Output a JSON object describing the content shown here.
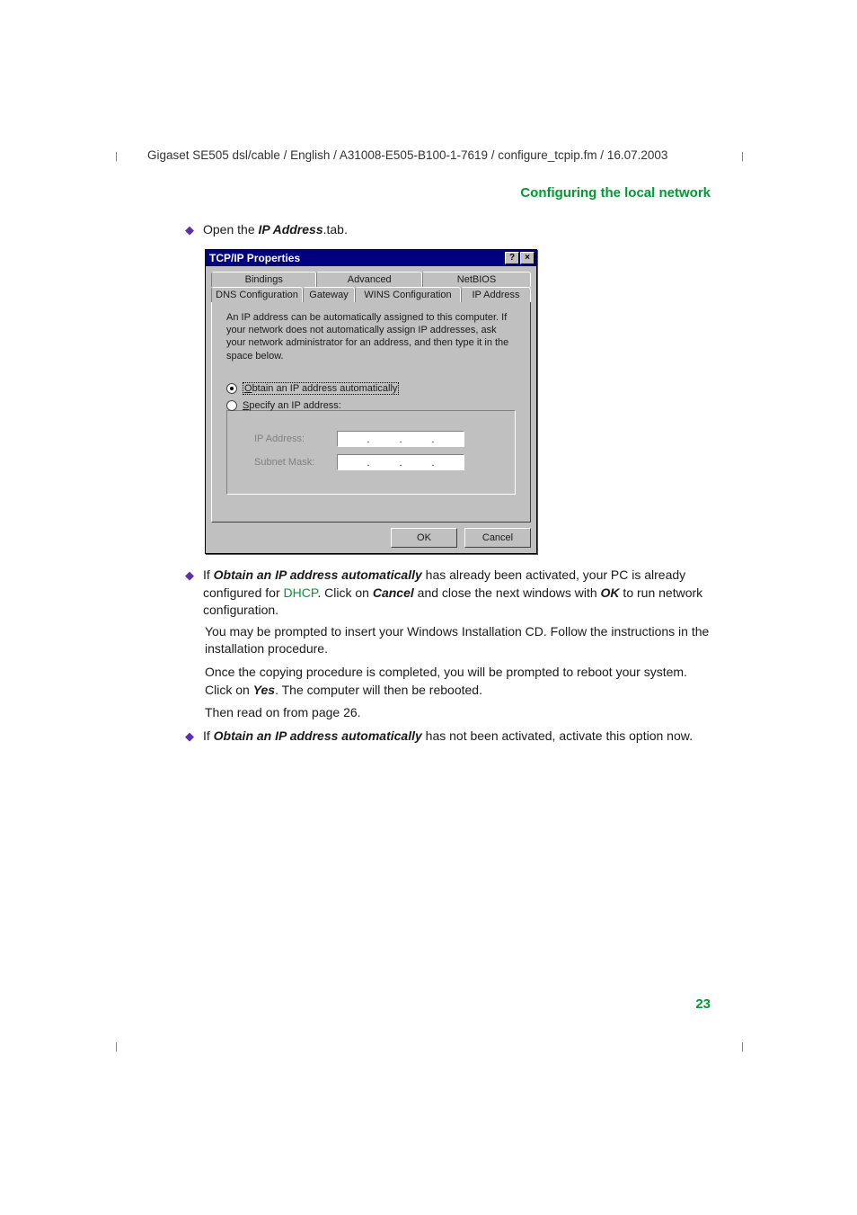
{
  "header_path": "Gigaset SE505 dsl/cable / English / A31008-E505-B100-1-7619 / configure_tcpip.fm / 16.07.2003",
  "section_title": "Configuring the local network",
  "bullet1_prefix": "Open the ",
  "bullet1_bold": "IP Address",
  "bullet1_suffix": ".tab.",
  "dialog": {
    "title": "TCP/IP Properties",
    "help": "?",
    "close": "×",
    "tabs": {
      "bindings": "Bindings",
      "advanced": "Advanced",
      "netbios": "NetBIOS",
      "dns": "DNS Configuration",
      "gateway": "Gateway",
      "wins": "WINS Configuration",
      "ip": "IP Address"
    },
    "desc": "An IP address can be automatically assigned to this computer. If your network does not automatically assign IP addresses, ask your network administrator for an address, and then type it in the space below.",
    "radio_auto": "Obtain an IP address automatically",
    "radio_spec": "Specify an IP address:",
    "ip_label": "IP Address:",
    "mask_label": "Subnet Mask:",
    "ok": "OK",
    "cancel": "Cancel"
  },
  "bullet2_p1_prefix": "If ",
  "bullet2_p1_bold1": "Obtain an IP address automatically",
  "bullet2_p1_mid1": " has already been activated, your PC is already configured for ",
  "bullet2_p1_green": "DHCP",
  "bullet2_p1_mid2": ". Click on ",
  "bullet2_p1_bold2": "Cancel",
  "bullet2_p1_mid3": " and close the next windows with ",
  "bullet2_p1_bold3": "OK",
  "bullet2_p1_suffix": " to run network configuration.",
  "bullet2_p2": "You may be prompted to insert your Windows Installation CD. Follow the instructions in the installation procedure.",
  "bullet2_p3_a": "Once the copying procedure is completed, you will be prompted to reboot your system. Click on ",
  "bullet2_p3_bold": "Yes",
  "bullet2_p3_b": ". The computer will then be rebooted.",
  "bullet2_p4": "Then read on from page 26.",
  "bullet3_prefix": "If ",
  "bullet3_bold": "Obtain an IP address automatically",
  "bullet3_suffix": " has not been activated, activate this option now.",
  "page_number": "23"
}
